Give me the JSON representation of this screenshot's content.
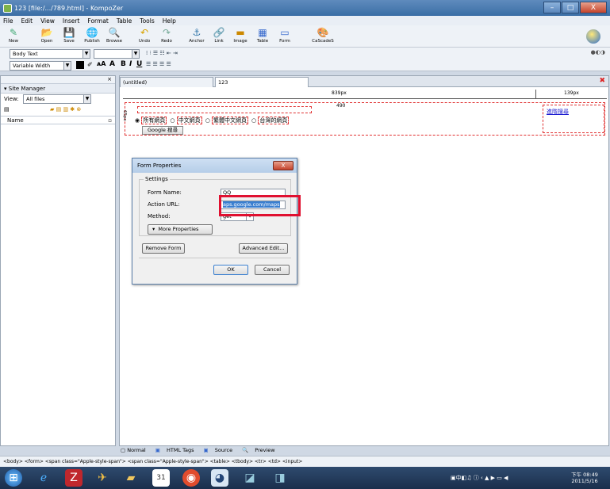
{
  "window": {
    "title": "123 [file:/.../789.html] - KompoZer",
    "min": "–",
    "max": "□",
    "close": "X"
  },
  "menu": [
    "File",
    "Edit",
    "View",
    "Insert",
    "Format",
    "Table",
    "Tools",
    "Help"
  ],
  "toolbar": [
    {
      "label": "New",
      "icon": "new-icon",
      "glyph": "✎"
    },
    {
      "label": "Open",
      "icon": "open-icon",
      "glyph": "📂"
    },
    {
      "label": "Save",
      "icon": "save-icon",
      "glyph": "💾"
    },
    {
      "label": "Publish",
      "icon": "publish-icon",
      "glyph": "🌐"
    },
    {
      "label": "Browse",
      "icon": "browse-icon",
      "glyph": "🔍"
    },
    {
      "label": "Undo",
      "icon": "undo-icon",
      "glyph": "↶"
    },
    {
      "label": "Redo",
      "icon": "redo-icon",
      "glyph": "↷"
    },
    {
      "label": "Anchor",
      "icon": "anchor-icon",
      "glyph": "⚓"
    },
    {
      "label": "Link",
      "icon": "link-icon",
      "glyph": "🔗"
    },
    {
      "label": "Image",
      "icon": "image-icon",
      "glyph": "▬"
    },
    {
      "label": "Table",
      "icon": "table-icon",
      "glyph": "▦"
    },
    {
      "label": "Form",
      "icon": "form-icon",
      "glyph": "▭"
    },
    {
      "label": "CaScadeS",
      "icon": "cascades-icon",
      "glyph": "🎨"
    }
  ],
  "format": {
    "paragraph": "Body Text",
    "font": "Variable Width",
    "bold": "B",
    "italic": "I",
    "underline": "U"
  },
  "sidebar": {
    "title": "Site Manager",
    "view_label": "View:",
    "view_value": "All files",
    "col_name": "Name",
    "close": "×"
  },
  "editor": {
    "tab1": "(untitled)",
    "tab2": "123",
    "ruler_main": "839px",
    "ruler_right": "139px",
    "ruler_inner": "490",
    "height_label": "65px",
    "radios": [
      "所有網頁",
      "中文網頁",
      "繁體中文網頁",
      "台灣的網頁"
    ],
    "button": "Google 搜尋",
    "link": "進階搜尋"
  },
  "dialog": {
    "title": "Form Properties",
    "close": "X",
    "settings": "Settings",
    "form_name_label": "Form Name:",
    "form_name_value": "QQ",
    "action_label": "Action URL:",
    "action_value": "aps.google.com/maps",
    "method_label": "Method:",
    "method_value": "get",
    "more": "More Properties",
    "remove": "Remove Form",
    "advanced": "Advanced Edit...",
    "ok": "OK",
    "cancel": "Cancel"
  },
  "bottom_tabs": [
    "Normal",
    "HTML Tags",
    "Source",
    "Preview"
  ],
  "status": "<body> <form> <span class=\"Apple-style-span\"> <span class=\"Apple-style-span\"> <table> <tbody> <tr> <td> <input>",
  "clock": {
    "time": "下午 08:49",
    "date": "2011/5/16"
  },
  "colors": {
    "highlight": "#e01030",
    "title_bar": "#3a6ea5",
    "selection": "#3a7fd0"
  }
}
